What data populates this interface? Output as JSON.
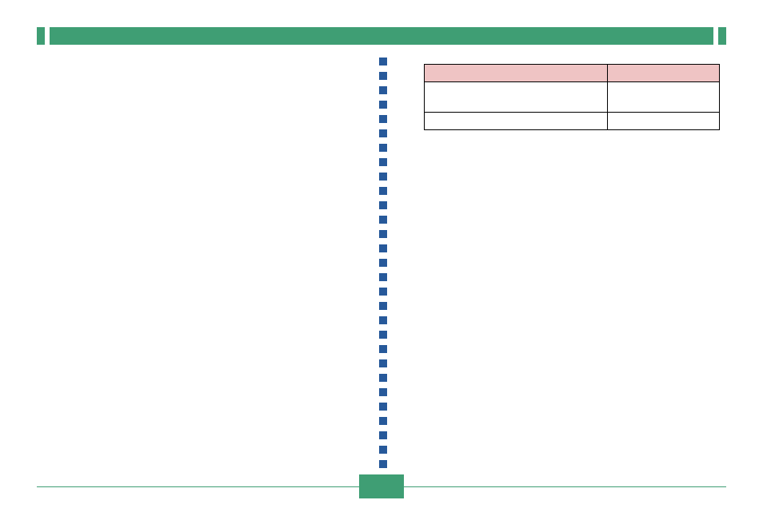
{
  "title_bar": {
    "text": ""
  },
  "table": {
    "headers": [
      "",
      ""
    ],
    "rows": [
      [
        "",
        ""
      ],
      [
        "",
        ""
      ]
    ]
  },
  "footer": {
    "page_label": ""
  }
}
